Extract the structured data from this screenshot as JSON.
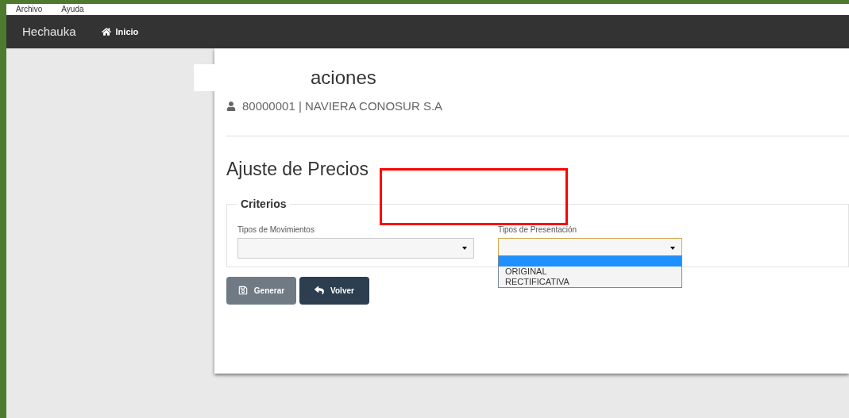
{
  "menu_bar": [
    "Archivo",
    "Ayuda"
  ],
  "navbar": {
    "brand": "Hechauka",
    "links": [
      {
        "label": "Inicio"
      }
    ]
  },
  "page": {
    "title_visible": "aciones",
    "taxpayer": "80000001 | NAVIERA CONOSUR S.A",
    "section_title": "Ajuste de Precios"
  },
  "criteria": {
    "legend": "Criterios",
    "fields": [
      {
        "label": "Tipos de Movimientos",
        "focused": false,
        "expanded": false
      },
      {
        "label": "Tipos de Presentación",
        "focused": true,
        "expanded": true,
        "options": [
          {
            "selected": true
          },
          {
            "label": "ORIGINAL",
            "selected": false
          },
          {
            "label": "RECTIFICATIVA",
            "selected": false
          }
        ]
      }
    ]
  },
  "buttons": [
    {
      "label": "Generar",
      "kind": "save"
    },
    {
      "label": "Volver",
      "kind": "back"
    }
  ]
}
